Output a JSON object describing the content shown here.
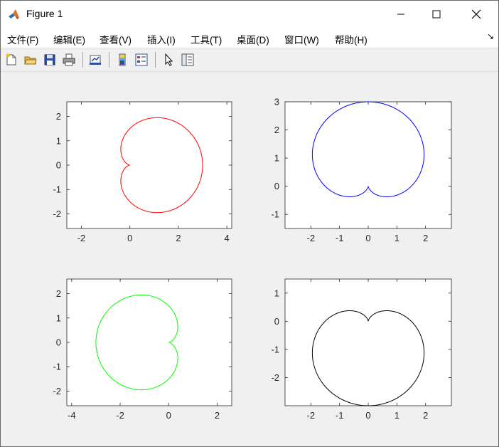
{
  "window": {
    "title": "Figure 1"
  },
  "menu": [
    {
      "label": "文件(F)"
    },
    {
      "label": "编辑(E)"
    },
    {
      "label": "查看(V)"
    },
    {
      "label": "插入(I)"
    },
    {
      "label": "工具(T)"
    },
    {
      "label": "桌面(D)"
    },
    {
      "label": "窗口(W)"
    },
    {
      "label": "帮助(H)"
    }
  ],
  "toolbar": {
    "icons": [
      "new-figure-icon",
      "open-file-icon",
      "save-icon",
      "print-icon",
      "link-plot-icon",
      "colorbar-icon",
      "legend-icon",
      "edit-plot-arrow-icon",
      "property-inspector-icon"
    ]
  },
  "colors": {
    "plot1": "#ff0000",
    "plot2": "#0000ff",
    "plot3": "#00ff00",
    "plot4": "#000000"
  },
  "chart_data": [
    {
      "type": "line",
      "series_color": "#ff0000",
      "equation_note": "cardioid opening left",
      "xlim": [
        -2.6,
        4.2
      ],
      "ylim": [
        -2.6,
        2.6
      ],
      "xticks": [
        "-2",
        "0",
        "2",
        "4"
      ],
      "yticks": [
        "-2",
        "-1",
        "0",
        "1",
        "2"
      ],
      "xtick_values": [
        -2,
        0,
        2,
        4
      ],
      "ytick_values": [
        -2,
        -1,
        0,
        1,
        2
      ]
    },
    {
      "type": "line",
      "series_color": "#0000ff",
      "xlim": [
        -2.9,
        2.9
      ],
      "ylim": [
        -1.5,
        3
      ],
      "xticks": [
        "-2",
        "-1",
        "0",
        "1",
        "2"
      ],
      "yticks": [
        "-1",
        "0",
        "1",
        "2",
        "3"
      ],
      "xtick_values": [
        -2,
        -1,
        0,
        1,
        2
      ],
      "ytick_values": [
        -1,
        0,
        1,
        2,
        3
      ]
    },
    {
      "type": "line",
      "series_color": "#00ff00",
      "xlim": [
        -4.2,
        2.6
      ],
      "ylim": [
        -2.6,
        2.6
      ],
      "xticks": [
        "-4",
        "-2",
        "0",
        "2"
      ],
      "yticks": [
        "-2",
        "-1",
        "0",
        "1",
        "2"
      ],
      "xtick_values": [
        -4,
        -2,
        0,
        2
      ],
      "ytick_values": [
        -2,
        -1,
        0,
        1,
        2
      ]
    },
    {
      "type": "line",
      "series_color": "#000000",
      "xlim": [
        -2.9,
        2.9
      ],
      "ylim": [
        -3,
        1.5
      ],
      "xticks": [
        "-2",
        "-1",
        "0",
        "1",
        "2"
      ],
      "yticks": [
        "-2",
        "-1",
        "0",
        "1"
      ],
      "xtick_values": [
        -2,
        -1,
        0,
        1,
        2
      ],
      "ytick_values": [
        -2,
        -1,
        0,
        1
      ]
    }
  ]
}
